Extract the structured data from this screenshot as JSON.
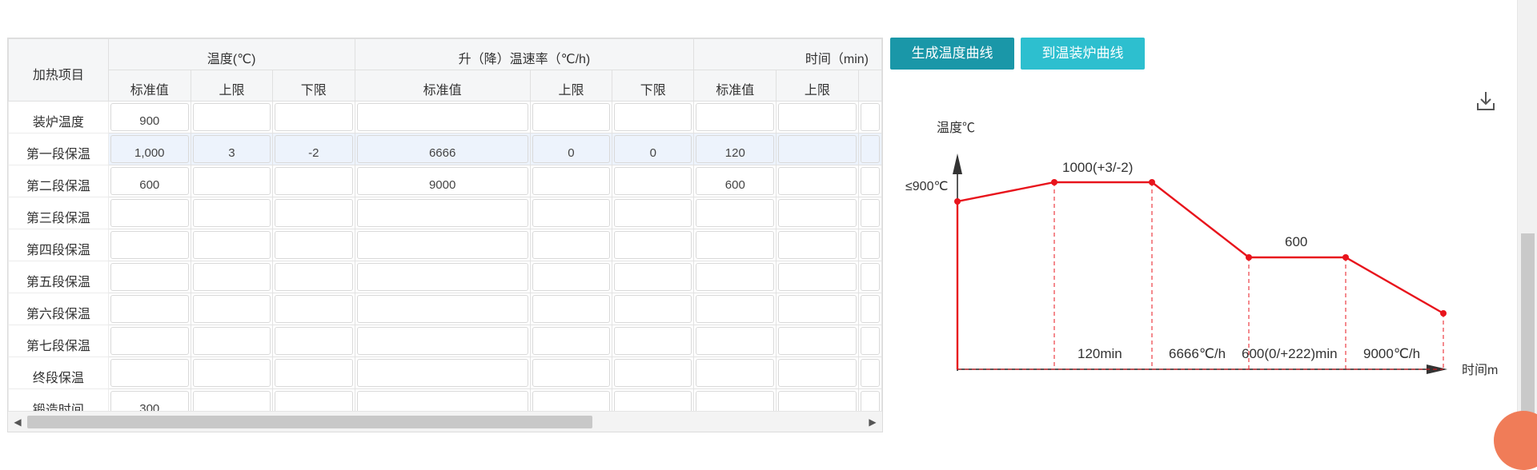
{
  "toolbar": {
    "generate_label": "生成温度曲线",
    "furnace_label": "到温装炉曲线"
  },
  "table": {
    "corner_label": "加热项目",
    "groups": {
      "temperature": "温度(℃)",
      "rate": "升（降）温速率（℃/h)",
      "time": "时间（min)"
    },
    "sub": {
      "standard": "标准值",
      "upper": "上限",
      "lower": "下限"
    },
    "rows": [
      {
        "label": "装炉温度",
        "cells": [
          "900",
          "",
          "",
          "",
          "",
          "",
          "",
          ""
        ]
      },
      {
        "label": "第一段保温",
        "cells": [
          "1,000",
          "3",
          "-2",
          "6666",
          "0",
          "0",
          "120",
          ""
        ]
      },
      {
        "label": "第二段保温",
        "cells": [
          "600",
          "",
          "",
          "9000",
          "",
          "",
          "600",
          ""
        ]
      },
      {
        "label": "第三段保温",
        "cells": [
          "",
          "",
          "",
          "",
          "",
          "",
          "",
          ""
        ]
      },
      {
        "label": "第四段保温",
        "cells": [
          "",
          "",
          "",
          "",
          "",
          "",
          "",
          ""
        ]
      },
      {
        "label": "第五段保温",
        "cells": [
          "",
          "",
          "",
          "",
          "",
          "",
          "",
          ""
        ]
      },
      {
        "label": "第六段保温",
        "cells": [
          "",
          "",
          "",
          "",
          "",
          "",
          "",
          ""
        ]
      },
      {
        "label": "第七段保温",
        "cells": [
          "",
          "",
          "",
          "",
          "",
          "",
          "",
          ""
        ]
      },
      {
        "label": "终段保温",
        "cells": [
          "",
          "",
          "",
          "",
          "",
          "",
          "",
          ""
        ]
      },
      {
        "label": "锻造时间",
        "cells": [
          "300",
          "",
          "",
          "",
          "",
          "",
          "",
          ""
        ]
      }
    ],
    "highlight_row": 1
  },
  "chart": {
    "y_axis_label": "温度℃",
    "x_axis_label": "时间m",
    "start_label": "≤900℃",
    "peak_label": "1000(+3/-2)",
    "second_label": "600",
    "segment_labels": [
      "120min",
      "6666℃/h",
      "600(0/+222)min",
      "9000℃/h"
    ],
    "line_color": "#e8141c"
  },
  "icons": {
    "download": "download-icon"
  }
}
